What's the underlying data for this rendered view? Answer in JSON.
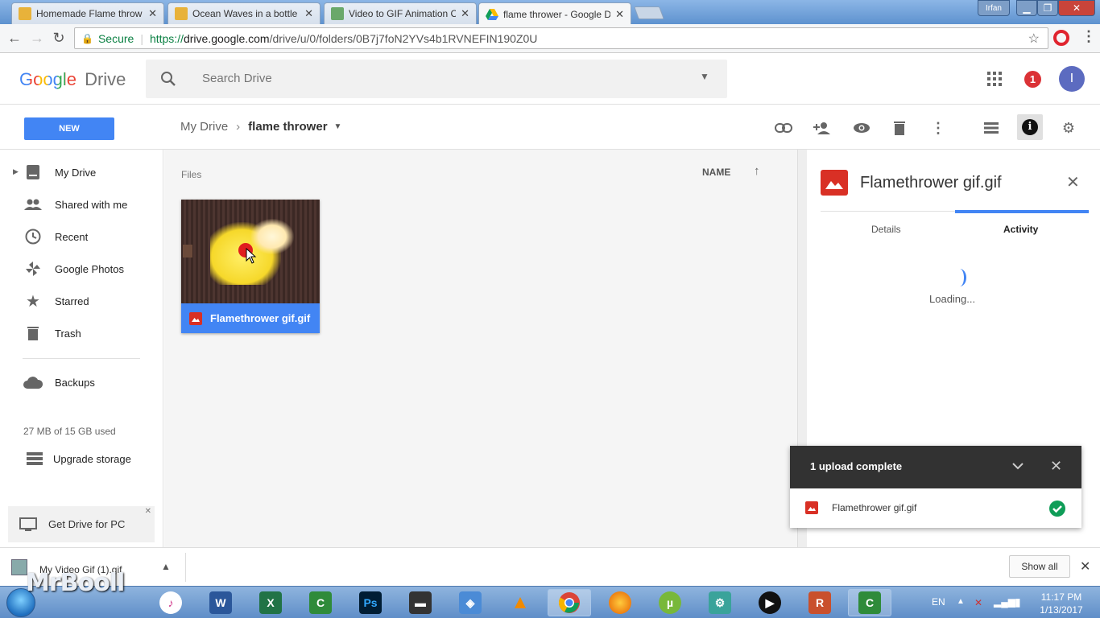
{
  "browser": {
    "tabs": [
      {
        "title": "Homemade Flame throw",
        "active": false
      },
      {
        "title": "Ocean Waves in a bottle",
        "active": false
      },
      {
        "title": "Video to GIF Animation C",
        "active": false
      },
      {
        "title": "flame thrower - Google D",
        "active": true
      }
    ],
    "user_badge": "Irfan",
    "secure_label": "Secure",
    "url_scheme": "https://",
    "url_host": "drive.google.com",
    "url_path": "/drive/u/0/folders/0B7j7foN2YVs4b1RVNEFIN190Z0U"
  },
  "drive": {
    "logo_google": "Google",
    "logo_drive": "Drive",
    "search_placeholder": "Search Drive",
    "notification_count": "1",
    "avatar_letter": "I",
    "new_label": "NEW",
    "breadcrumb_root": "My Drive",
    "breadcrumb_current": "flame thrower",
    "sidebar": {
      "items": [
        {
          "label": "My Drive",
          "icon": "drive-icon"
        },
        {
          "label": "Shared with me",
          "icon": "people-icon"
        },
        {
          "label": "Recent",
          "icon": "clock-icon"
        },
        {
          "label": "Google Photos",
          "icon": "pinwheel-icon"
        },
        {
          "label": "Starred",
          "icon": "star-icon"
        },
        {
          "label": "Trash",
          "icon": "trash-icon"
        }
      ],
      "backups_label": "Backups",
      "storage_used": "27 MB of 15 GB used",
      "upgrade_label": "Upgrade storage",
      "get_drive_label": "Get Drive for PC"
    },
    "main": {
      "section_label": "Files",
      "sort_label": "NAME",
      "file_name": "Flamethrower gif.gif"
    },
    "panel": {
      "title": "Flamethrower gif.gif",
      "tab_details": "Details",
      "tab_activity": "Activity",
      "loading_text": "Loading..."
    },
    "toast": {
      "title": "1 upload complete",
      "file_name": "Flamethrower gif.gif"
    }
  },
  "downloads": {
    "file_name": "My Video Gif (1).gif",
    "show_all": "Show all"
  },
  "taskbar": {
    "language": "EN",
    "time": "11:17 PM",
    "date": "1/13/2017",
    "watermark": "MrBooll"
  },
  "colors": {
    "accent_blue": "#4285f4",
    "drive_red": "#d93025",
    "success_green": "#0f9d58",
    "toast_dark": "#323232"
  }
}
